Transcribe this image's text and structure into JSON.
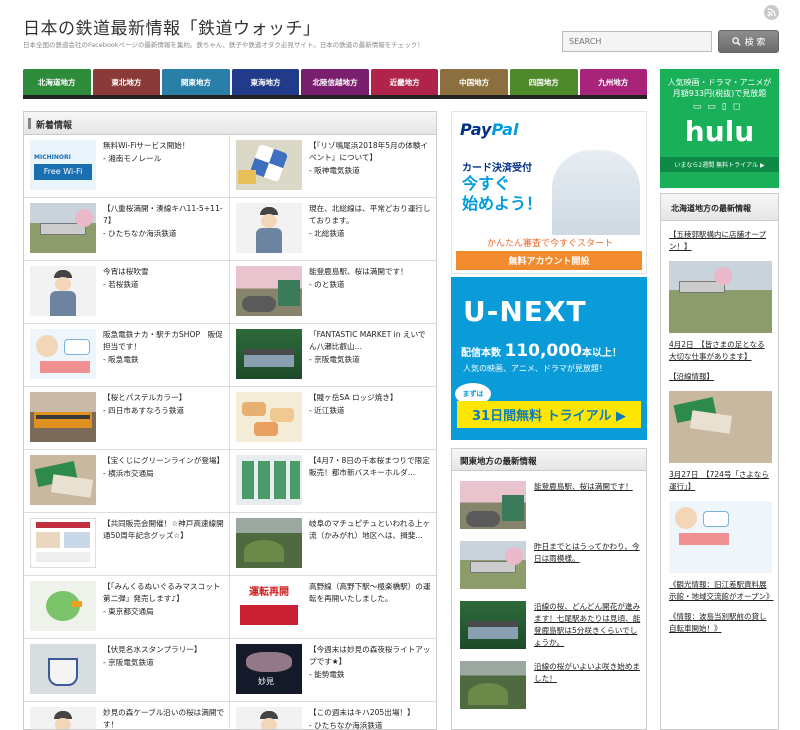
{
  "header": {
    "title": "日本の鉄道最新情報「鉄道ウォッチ」",
    "description": "日本全国の鉄道会社のFacebookページの最新情報を集約。鉄ちゃん、鉄子や鉄道オタク必見サイト。日本の鉄道の最新情報をチェック！",
    "search_placeholder": "SEARCH",
    "search_button": "検 索"
  },
  "nav": {
    "items": [
      {
        "label": "北海道地方",
        "color": "#2e8b3a"
      },
      {
        "label": "東北地方",
        "color": "#8b3a3a"
      },
      {
        "label": "関東地方",
        "color": "#2a7fa8"
      },
      {
        "label": "東海地方",
        "color": "#223a8a"
      },
      {
        "label": "北陸信越地方",
        "color": "#7a1f6e"
      },
      {
        "label": "近畿地方",
        "color": "#b0244a"
      },
      {
        "label": "中国地方",
        "color": "#8c6f3e"
      },
      {
        "label": "四国地方",
        "color": "#4f8a2a"
      },
      {
        "label": "九州地方",
        "color": "#a8237a"
      }
    ]
  },
  "news": {
    "heading": "新着情報",
    "items": [
      {
        "title": "無料Wi-Fiサービス開始！",
        "company": "- 湘南モノレール",
        "thumb": "wifi"
      },
      {
        "title": "【『リゾ鳴尾浜2018年5月の体験イベント』について】",
        "company": "- 阪神電気鉄道",
        "thumb": "windmill"
      },
      {
        "title": "【八重桜満開・湊線キハ11-5+11-7】",
        "company": "- ひたちなか海浜鉄道",
        "thumb": "train-field"
      },
      {
        "title": "現在、北総線は、平常どおり運行しております。",
        "company": "- 北総鉄道",
        "thumb": "staff"
      },
      {
        "title": "今宵は桜吹雪",
        "company": "- 若桜鉄道",
        "thumb": "staff"
      },
      {
        "title": "能登鹿島駅、桜は満開です！",
        "company": "- のと鉄道",
        "thumb": "crowd"
      },
      {
        "title": "阪急電鉄ナカ・駅チカSHOP　販促担当です！",
        "company": "- 阪急電鉄",
        "thumb": "shop"
      },
      {
        "title": "「FANTASTIC MARKET in えいでん八瀬比叡山…",
        "company": "- 京阪電気鉄道",
        "thumb": "forest"
      },
      {
        "title": "【桜とパステルカラー】",
        "company": "- 四日市あすなろう鉄道",
        "thumb": "train-orange"
      },
      {
        "title": "【賤ヶ岳SA ロッジ焼き】",
        "company": "- 近江鉄道",
        "thumb": "sweets"
      },
      {
        "title": "【宝くじにグリーンラインが登場】",
        "company": "- 横浜市交通局",
        "thumb": "tickets"
      },
      {
        "title": "【4月7・8日の千本桜まつりで限定販売！都市新バスキーホルダ…",
        "company": "",
        "thumb": "keychains"
      },
      {
        "title": "【共同販売会開催！☆神戸高速線開通50周年記念グッズ☆】",
        "company": "",
        "thumb": "flyer"
      },
      {
        "title": "岐阜のマチュピチュといわれる上ヶ流（かみがれ）地区へは、揖斐…",
        "company": "",
        "thumb": "hills"
      },
      {
        "title": "【「みんくるぬいぐるみマスコット第二弾」発売します♪】",
        "company": "- 東京都交通局",
        "thumb": "bird"
      },
      {
        "title": "高野線（高野下駅〜極楽橋駅）の運転を再開いたしました。",
        "company": "",
        "thumb": "resume"
      },
      {
        "title": "【伏見名水スタンプラリー】",
        "company": "- 京阪電気鉄道",
        "thumb": "cup"
      },
      {
        "title": "【今週末は妙見の森夜桜ライトアップです★】",
        "company": "- 能勢電鉄",
        "thumb": "night"
      },
      {
        "title": "妙見の森ケーブル沿いの桜は満開です！",
        "company": "",
        "thumb": "staff"
      },
      {
        "title": "【この週末はキハ205出場！】",
        "company": "- ひたちなか海浜鉄道",
        "thumb": "staff"
      }
    ]
  },
  "ads": {
    "paypal": {
      "logo_a": "Pay",
      "logo_b": "Pal",
      "line1": "カード決済受付",
      "line2": "今すぐ",
      "line3": "始めよう！",
      "line4": "かんたん審査で今すぐスタート",
      "button": "無料アカウント開設"
    },
    "unext": {
      "logo": "U-NEXT",
      "line1a": "配信本数",
      "line1b": "110,000",
      "line1c": "本以上！",
      "line2": "人気の映画、アニメ、ドラマが見放題！",
      "badge": "まずは",
      "free": "31日間無料 トライアル ▶"
    },
    "hulu": {
      "line1": "人気映画・ドラマ・アニメが",
      "line2": "月額933円(税抜)で見放題",
      "icons": "▭▭▯◻",
      "logo": "hulu",
      "trial": "いまなら2週間 無料トライアル ▶"
    }
  },
  "kanto": {
    "heading": "関東地方の最新情報",
    "items": [
      {
        "title": "能登鹿島駅、桜は満開です！"
      },
      {
        "title": "昨日までとはうってかわり、今日は雨模様。"
      },
      {
        "title": "沿線の桜、どんどん開花が進みます！七尾駅あたりは見頃、能登鹿島駅は5分咲きくらいでしょうか。"
      },
      {
        "title": "沿線の桜がいよいよ咲き始めました！"
      }
    ]
  },
  "hokkaido": {
    "heading": "北海道地方の最新情報",
    "items": [
      {
        "text": "【五稜郭駅構内に店舗オープン！】",
        "date": ""
      },
      {
        "text": "4月2日　【皆さまの足となる大切な仕事があります】",
        "date": ""
      },
      {
        "text": "【沿線情報】",
        "date": ""
      },
      {
        "text": "3月27日　【724号「さよなら運行」】",
        "date": ""
      },
      {
        "text": "《観光情報：旧江差駅資料展示館・地域交流館がオープン》",
        "date": ""
      },
      {
        "text": "《情報：波島当別駅前の貸し自転車開始！》",
        "date": ""
      }
    ]
  }
}
